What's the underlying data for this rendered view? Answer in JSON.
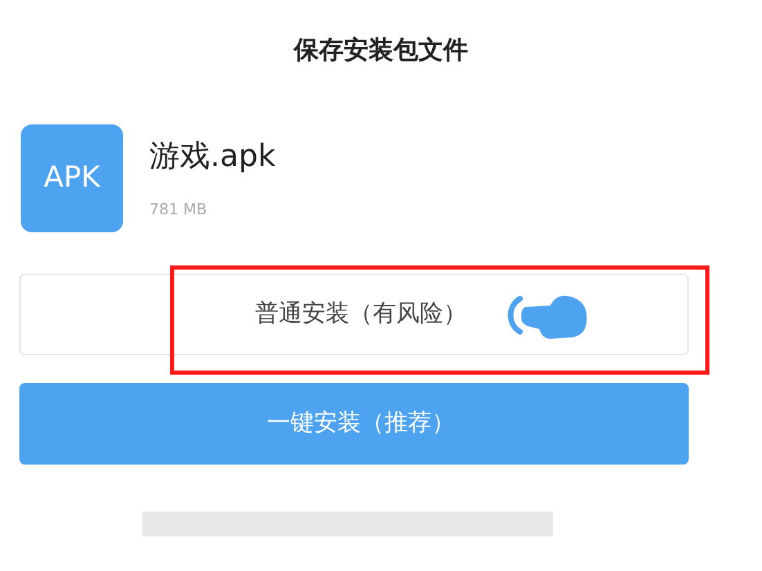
{
  "dialog": {
    "title": "保存安装包文件"
  },
  "file": {
    "icon_label": "APK",
    "name": "游戏.apk",
    "size": "781 MB"
  },
  "buttons": [
    {
      "label": "普通安装（有风险）",
      "kind": "outline",
      "highlighted": true
    },
    {
      "label": "一键安装（推荐）",
      "kind": "primary",
      "highlighted": false
    }
  ]
}
